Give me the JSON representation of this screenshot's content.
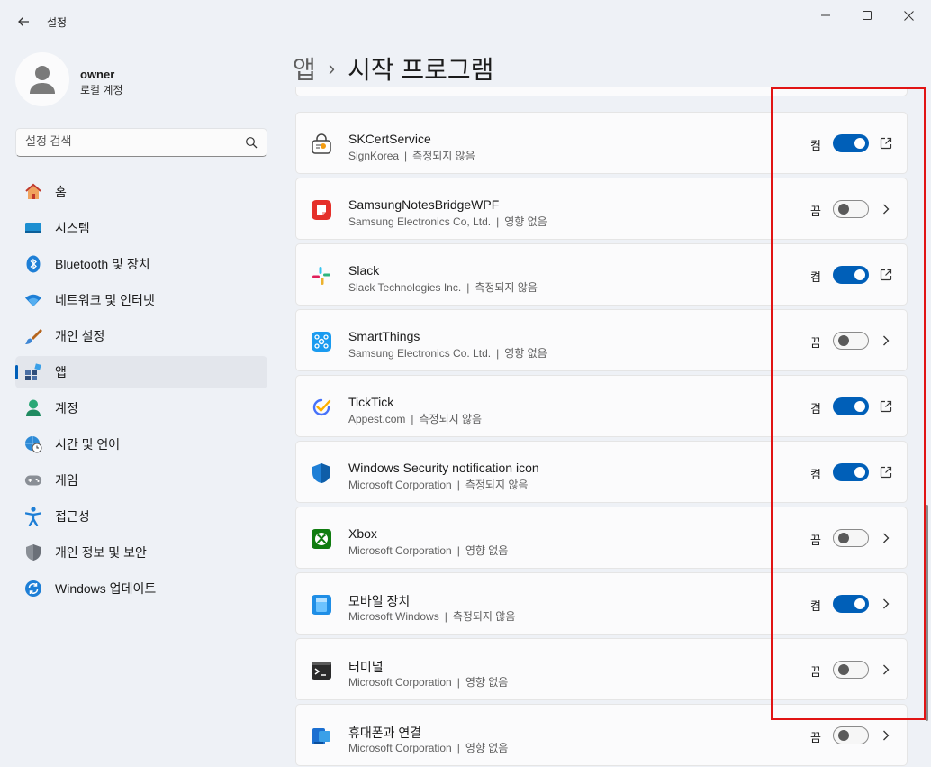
{
  "window": {
    "title": "설정"
  },
  "profile": {
    "name": "owner",
    "account_type": "로컬 계정"
  },
  "search": {
    "placeholder": "설정 검색"
  },
  "nav": [
    {
      "id": "home",
      "label": "홈",
      "icon": "home-icon"
    },
    {
      "id": "system",
      "label": "시스템",
      "icon": "monitor-icon"
    },
    {
      "id": "bluetooth",
      "label": "Bluetooth 및 장치",
      "icon": "bluetooth-icon"
    },
    {
      "id": "network",
      "label": "네트워크 및 인터넷",
      "icon": "wifi-icon"
    },
    {
      "id": "personalization",
      "label": "개인 설정",
      "icon": "brush-icon"
    },
    {
      "id": "apps",
      "label": "앱",
      "icon": "apps-icon",
      "active": true
    },
    {
      "id": "accounts",
      "label": "계정",
      "icon": "person-icon"
    },
    {
      "id": "time",
      "label": "시간 및 언어",
      "icon": "globe-clock-icon"
    },
    {
      "id": "gaming",
      "label": "게임",
      "icon": "gamepad-icon"
    },
    {
      "id": "accessibility",
      "label": "접근성",
      "icon": "accessibility-icon"
    },
    {
      "id": "privacy",
      "label": "개인 정보 및 보안",
      "icon": "shield-icon"
    },
    {
      "id": "update",
      "label": "Windows 업데이트",
      "icon": "sync-icon"
    }
  ],
  "breadcrumb": {
    "parent": "앱",
    "separator": "›",
    "current": "시작 프로그램"
  },
  "startup_apps": [
    {
      "name": "SKCertService",
      "publisher": "SignKorea",
      "impact": "측정되지 않음",
      "state": "켬",
      "enabled": true,
      "action": "open-external-icon",
      "icon": "skcert-icon"
    },
    {
      "name": "SamsungNotesBridgeWPF",
      "publisher": "Samsung Electronics Co, Ltd.",
      "impact": "영향 없음",
      "state": "끔",
      "enabled": false,
      "action": "chevron-right-icon",
      "icon": "samsung-notes-icon"
    },
    {
      "name": "Slack",
      "publisher": "Slack Technologies Inc.",
      "impact": "측정되지 않음",
      "state": "켬",
      "enabled": true,
      "action": "open-external-icon",
      "icon": "slack-icon"
    },
    {
      "name": "SmartThings",
      "publisher": "Samsung Electronics Co. Ltd.",
      "impact": "영향 없음",
      "state": "끔",
      "enabled": false,
      "action": "chevron-right-icon",
      "icon": "smartthings-icon"
    },
    {
      "name": "TickTick",
      "publisher": "Appest.com",
      "impact": "측정되지 않음",
      "state": "켬",
      "enabled": true,
      "action": "open-external-icon",
      "icon": "ticktick-icon"
    },
    {
      "name": "Windows Security notification icon",
      "publisher": "Microsoft Corporation",
      "impact": "측정되지 않음",
      "state": "켬",
      "enabled": true,
      "action": "open-external-icon",
      "icon": "windows-security-icon"
    },
    {
      "name": "Xbox",
      "publisher": "Microsoft Corporation",
      "impact": "영향 없음",
      "state": "끔",
      "enabled": false,
      "action": "chevron-right-icon",
      "icon": "xbox-icon"
    },
    {
      "name": "모바일 장치",
      "publisher": "Microsoft Windows",
      "impact": "측정되지 않음",
      "state": "켬",
      "enabled": true,
      "action": "chevron-right-icon",
      "icon": "mobile-device-icon"
    },
    {
      "name": "터미널",
      "publisher": "Microsoft Corporation",
      "impact": "영향 없음",
      "state": "끔",
      "enabled": false,
      "action": "chevron-right-icon",
      "icon": "terminal-icon"
    },
    {
      "name": "휴대폰과 연결",
      "publisher": "Microsoft Corporation",
      "impact": "영향 없음",
      "state": "끔",
      "enabled": false,
      "action": "chevron-right-icon",
      "icon": "phone-link-icon"
    }
  ],
  "separator_char": "|",
  "colors": {
    "accent": "#005fb8",
    "highlight_box": "#e11414"
  }
}
